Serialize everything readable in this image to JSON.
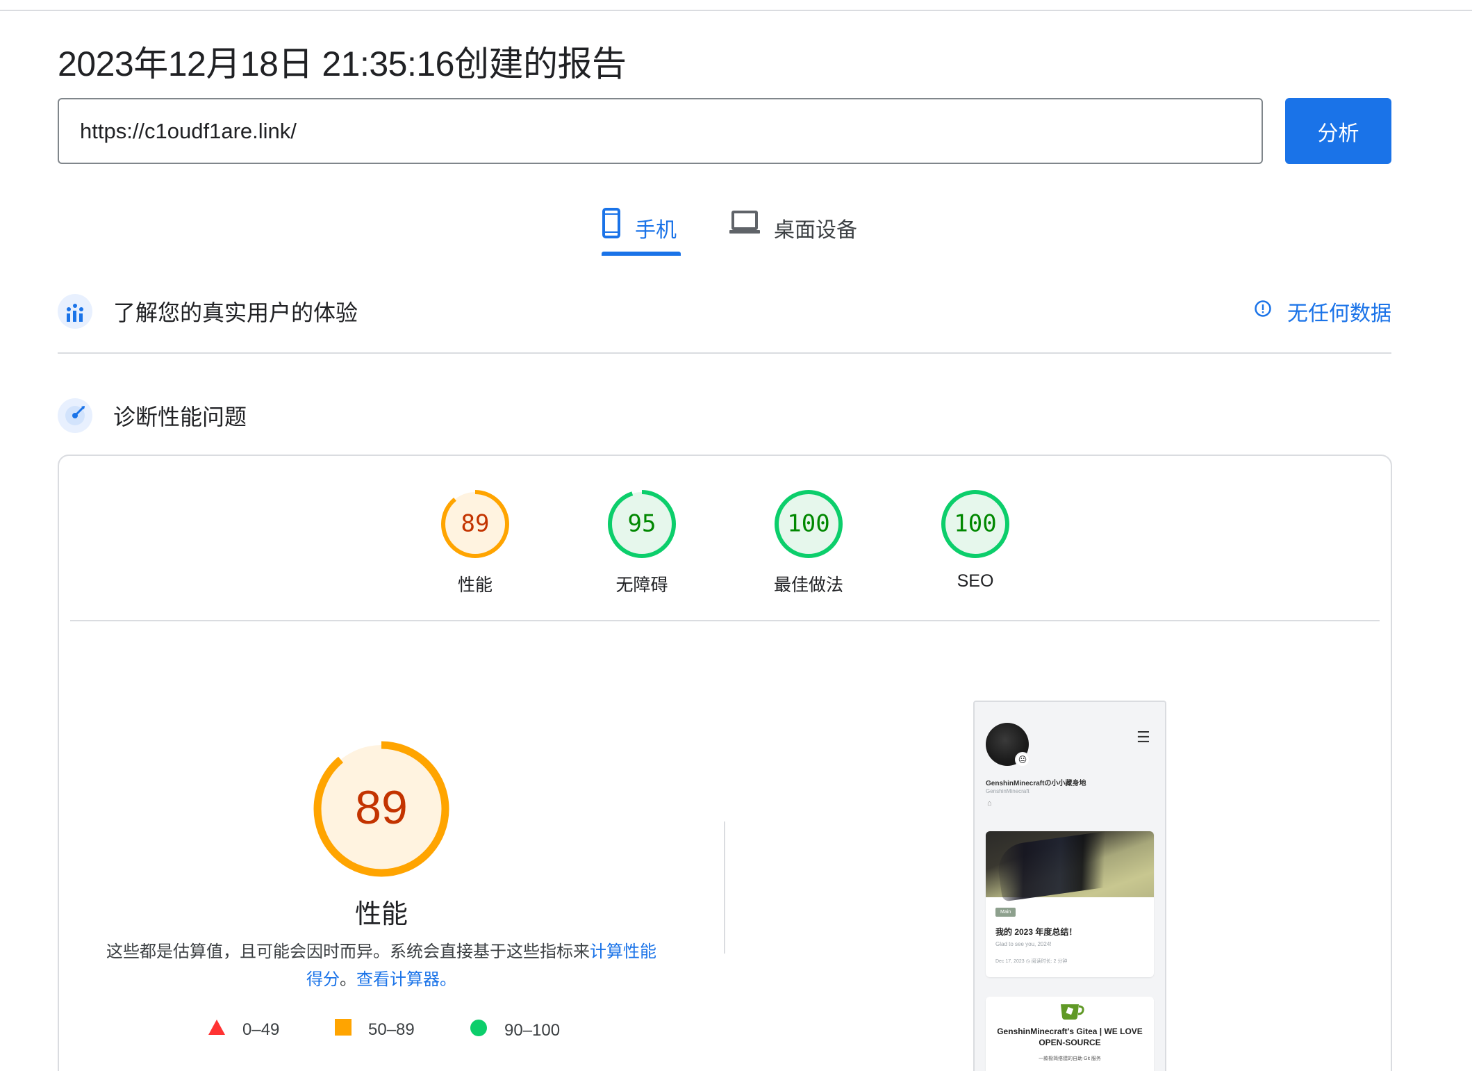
{
  "report": {
    "title": "2023年12月18日 21:35:16创建的报告",
    "url_value": "https://c1oudf1are.link/",
    "analyze_label": "分析"
  },
  "tabs": [
    {
      "label": "手机",
      "icon": "phone-icon",
      "active": true
    },
    {
      "label": "桌面设备",
      "icon": "laptop-icon",
      "active": false
    }
  ],
  "crux": {
    "title": "了解您的真实用户的体验",
    "icon": "users-chart-icon",
    "no_data_label": "无任何数据",
    "no_data_icon": "info-icon"
  },
  "diagnose": {
    "title": "诊断性能问题",
    "icon": "lighthouse-icon"
  },
  "scores": [
    {
      "label": "性能",
      "value": "89",
      "status": "average"
    },
    {
      "label": "无障碍",
      "value": "95",
      "status": "pass"
    },
    {
      "label": "最佳做法",
      "value": "100",
      "status": "pass"
    },
    {
      "label": "SEO",
      "value": "100",
      "status": "pass"
    }
  ],
  "performance": {
    "score": "89",
    "label": "性能",
    "desc_prefix": "这些都是估算值，且可能会因时而异。系统会直接基于这些指标来",
    "desc_link1": "计算性能得分",
    "desc_mid": "。",
    "desc_link2": "查看计算器。"
  },
  "legend": [
    {
      "range": "0–49",
      "shape": "triangle",
      "color": "#ff3333"
    },
    {
      "range": "50–89",
      "shape": "square",
      "color": "#ffa400"
    },
    {
      "range": "90–100",
      "shape": "circle",
      "color": "#0cce6b"
    }
  ],
  "colors": {
    "accent": "#1a73e8",
    "average": "#ffa400",
    "average_text": "#c33300",
    "average_bg": "#fff3e0",
    "pass": "#0cce6b",
    "pass_text": "#008800",
    "pass_bg": "#e6f7ec"
  },
  "screenshot": {
    "site_name": "GenshinMinecraftの小小藏身地",
    "site_sub": "GenshinMinecraft",
    "post_tag": "Main",
    "post_title": "我的 2023 年度总结！",
    "post_sub": "Glad to see you, 2024!",
    "post_meta": "Dec 17, 2023   ◷  阅读时长: 2 分钟",
    "card2_title": "GenshinMinecraft's Gitea | WE LOVE OPEN-SOURCE",
    "card2_sub": "一款极简搭建的自助 Git 服务"
  }
}
